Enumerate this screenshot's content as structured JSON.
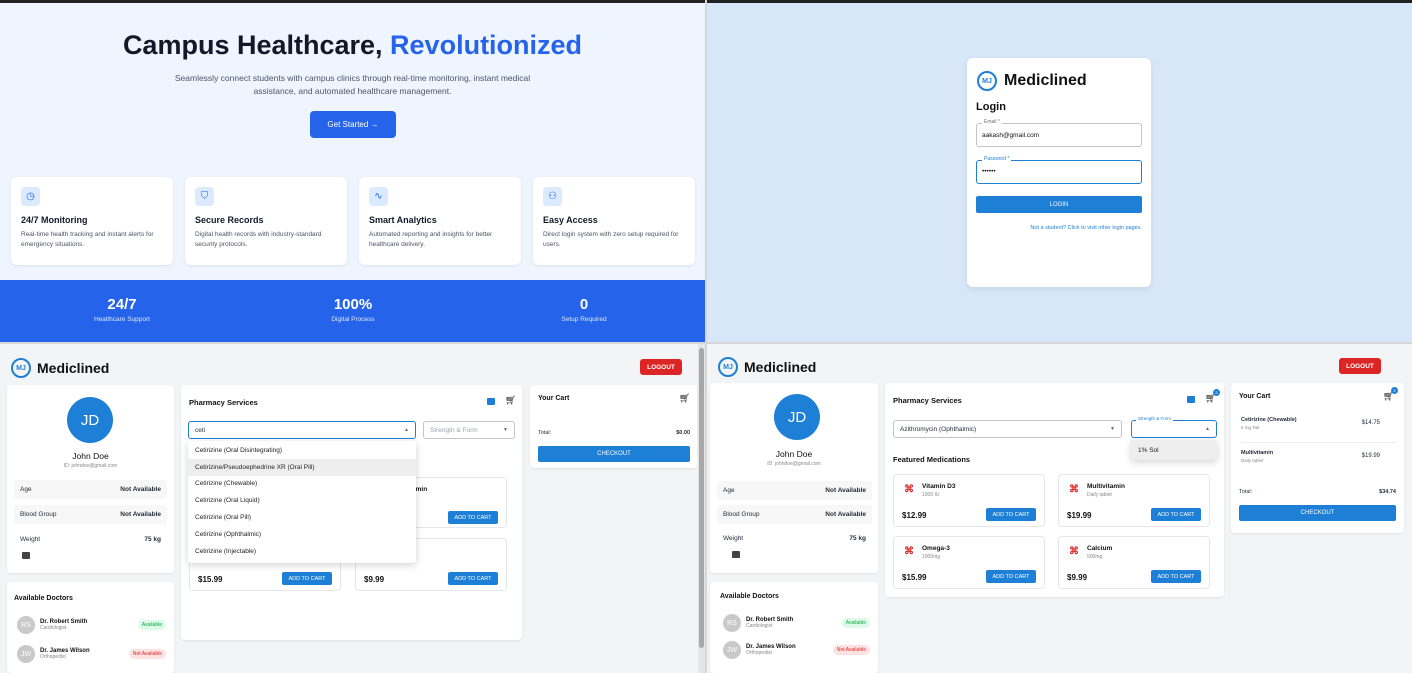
{
  "landing": {
    "title_main": "Campus Healthcare, ",
    "title_accent": "Revolutionized",
    "subtitle": "Seamlessly connect students with campus clinics through real-time monitoring, instant medical assistance, and automated healthcare management.",
    "cta_label": "Get Started →",
    "features": [
      {
        "icon": "clock-icon",
        "glyph": "◷",
        "title": "24/7 Monitoring",
        "desc": "Real-time health tracking and instant alerts for emergency situations."
      },
      {
        "icon": "shield-icon",
        "glyph": "⛉",
        "title": "Secure Records",
        "desc": "Digital health records with industry-standard security protocols."
      },
      {
        "icon": "activity-icon",
        "glyph": "∿",
        "title": "Smart Analytics",
        "desc": "Automated reporting and insights for better healthcare delivery."
      },
      {
        "icon": "users-icon",
        "glyph": "⚇",
        "title": "Easy Access",
        "desc": "Direct login system with zero setup required for users."
      }
    ],
    "stats": [
      {
        "value": "24/7",
        "label": "Healthcare Support"
      },
      {
        "value": "100%",
        "label": "Digital Process"
      },
      {
        "value": "0",
        "label": "Setup Required"
      }
    ]
  },
  "login": {
    "logo_mark": "MJ",
    "brand": "Mediclined",
    "heading": "Login",
    "email_label": "Email *",
    "email_value": "aakash@gmail.com",
    "password_label": "Password *",
    "password_value": "••••••",
    "login_button": "LOGIN",
    "other_link": "Not a student? Click to visit other login pages."
  },
  "dash_left": {
    "brand": "Mediclined",
    "logo_mark": "MJ",
    "logout": "LOGOUT",
    "profile": {
      "initials": "JD",
      "name": "John Doe",
      "id_line": "ID: johndoe@gmail.com"
    },
    "info": [
      {
        "label": "Age",
        "value": "Not Available"
      },
      {
        "label": "Blood Group",
        "value": "Not Available"
      },
      {
        "label": "Weight",
        "value": "75 kg"
      }
    ],
    "doctors_title": "Available Doctors",
    "doctors": [
      {
        "initials": "RS",
        "name": "Dr. Robert Smith",
        "spec": "Cardiologist",
        "status": "Available"
      },
      {
        "initials": "JW",
        "name": "Dr. James Wilson",
        "spec": "Orthopedist",
        "status": "Not Available"
      }
    ],
    "pharmacy_title": "Pharmacy Services",
    "search_value": "ceti",
    "strength_placeholder": "Strength & Form",
    "dropdown": [
      "Cetirizine (Oral Disintegrating)",
      "Cetirizine/Pseudoephedrine XR (Oral Pill)",
      "Cetirizine (Chewable)",
      "Cetirizine (Oral Liquid)",
      "Cetirizine (Oral Pill)",
      "Cetirizine (Ophthalmic)",
      "Cetirizine (Injectable)"
    ],
    "peek_name": "amin",
    "meds": [
      {
        "price": "$15.99",
        "button": "ADD TO CART"
      },
      {
        "price": "$9.99",
        "button": "ADD TO CART"
      },
      {
        "button": "ADD TO CART"
      }
    ],
    "cart_title": "Your Cart",
    "total_label": "Total:",
    "total_value": "$0.00",
    "checkout": "CHECKOUT"
  },
  "dash_right": {
    "brand": "Mediclined",
    "logo_mark": "MJ",
    "logout": "LOGOUT",
    "profile": {
      "initials": "JD",
      "name": "John Doe",
      "id_line": "ID: johndoe@gmail.com"
    },
    "info": [
      {
        "label": "Age",
        "value": "Not Available"
      },
      {
        "label": "Blood Group",
        "value": "Not Available"
      },
      {
        "label": "Weight",
        "value": "75 kg"
      }
    ],
    "doctors_title": "Available Doctors",
    "doctors": [
      {
        "initials": "RS",
        "name": "Dr. Robert Smith",
        "spec": "Cardiologist",
        "status": "Available"
      },
      {
        "initials": "JW",
        "name": "Dr. James Wilson",
        "spec": "Orthopedist",
        "status": "Not Available"
      }
    ],
    "pharmacy_title": "Pharmacy Services",
    "search_value": "Azithromycin (Ophthalmic)",
    "strength_label": "Strength & Form",
    "strength_option": "1% Sol",
    "cart_badge": "2",
    "featured_title": "Featured Medications",
    "meds": [
      {
        "name": "Vitamin D3",
        "dose": "1000 IU",
        "price": "$12.99",
        "button": "ADD TO CART"
      },
      {
        "name": "Multivitamin",
        "dose": "Daily tablet",
        "price": "$19.99",
        "button": "ADD TO CART"
      },
      {
        "name": "Omega-3",
        "dose": "1000mg",
        "price": "$15.99",
        "button": "ADD TO CART"
      },
      {
        "name": "Calcium",
        "dose": "500mg",
        "price": "$9.99",
        "button": "ADD TO CART"
      }
    ],
    "cart_title": "Your Cart",
    "cart_items": [
      {
        "name": "Cetirizine (Chewable)",
        "dose": "5 mg Tab",
        "price": "$14.75"
      },
      {
        "name": "Multivitamin",
        "dose": "Daily tablet",
        "price": "$19.99"
      }
    ],
    "total_label": "Total:",
    "total_value": "$34.74",
    "checkout": "CHECKOUT"
  },
  "colors": {
    "primary": "#2563eb",
    "brand": "#1e7fd6",
    "danger": "#dc2626",
    "success": "#16a34a"
  }
}
